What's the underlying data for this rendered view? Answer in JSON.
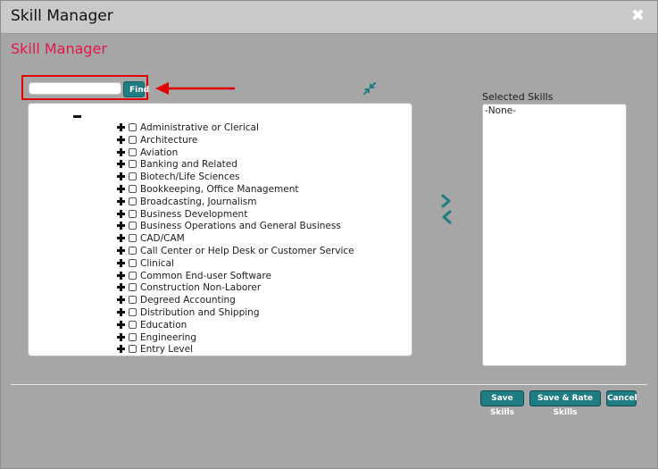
{
  "window": {
    "title": "Skill Manager",
    "close_label": "✖"
  },
  "heading": "Skill Manager",
  "search": {
    "value": "",
    "placeholder": "",
    "find_label": "Find"
  },
  "tree": {
    "items": [
      {
        "label": "Administrative or Clerical"
      },
      {
        "label": "Architecture"
      },
      {
        "label": "Aviation"
      },
      {
        "label": "Banking and Related"
      },
      {
        "label": "Biotech/Life Sciences"
      },
      {
        "label": "Bookkeeping, Office Management"
      },
      {
        "label": "Broadcasting, Journalism"
      },
      {
        "label": "Business Development"
      },
      {
        "label": "Business Operations and General Business"
      },
      {
        "label": "CAD/CAM"
      },
      {
        "label": "Call Center or Help Desk or Customer Service"
      },
      {
        "label": "Clinical"
      },
      {
        "label": "Common End-user Software"
      },
      {
        "label": "Construction Non-Laborer"
      },
      {
        "label": "Degreed Accounting"
      },
      {
        "label": "Distribution and Shipping"
      },
      {
        "label": "Education"
      },
      {
        "label": "Engineering"
      },
      {
        "label": "Entry Level"
      }
    ]
  },
  "selected": {
    "label": "Selected Skills",
    "empty_text": "-None-"
  },
  "footer": {
    "save_label": "Save Skills",
    "save_rate_label": "Save & Rate Skills",
    "cancel_label": "Cancel"
  },
  "colors": {
    "accent": "#1e7c82",
    "heading": "#e4164b",
    "annotation": "#e00000"
  }
}
